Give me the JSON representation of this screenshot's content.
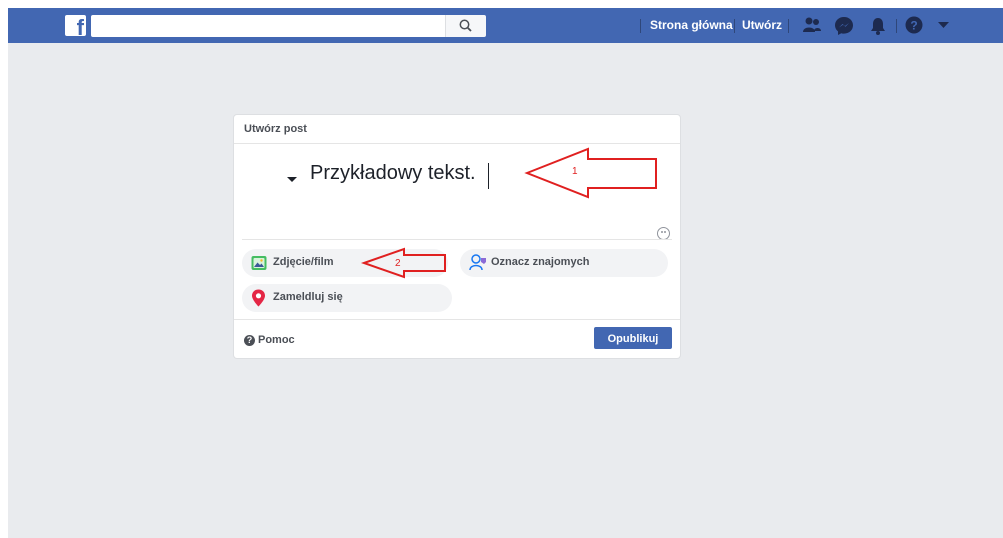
{
  "topbar": {
    "logo_letter": "f",
    "search_placeholder": "",
    "nav": {
      "home_label": "Strona główna",
      "create_label": "Utwórz"
    },
    "icons": [
      "friends-icon",
      "messenger-icon",
      "notifications-icon",
      "help-icon",
      "dropdown-icon"
    ]
  },
  "composer": {
    "title": "Utwórz post",
    "text": "Przykładowy tekst.",
    "actions": {
      "photo_label": "Zdjęcie/film",
      "tag_label": "Oznacz znajomych",
      "checkin_label": "Zameldluj się"
    },
    "footer": {
      "help_label": "Pomoc",
      "publish_label": "Opublikuj"
    }
  },
  "annotations": {
    "arrow1_label": "1",
    "arrow2_label": "2"
  },
  "colors": {
    "brand": "#4267b2",
    "background": "#e9ebee",
    "annotation": "#e02020"
  }
}
